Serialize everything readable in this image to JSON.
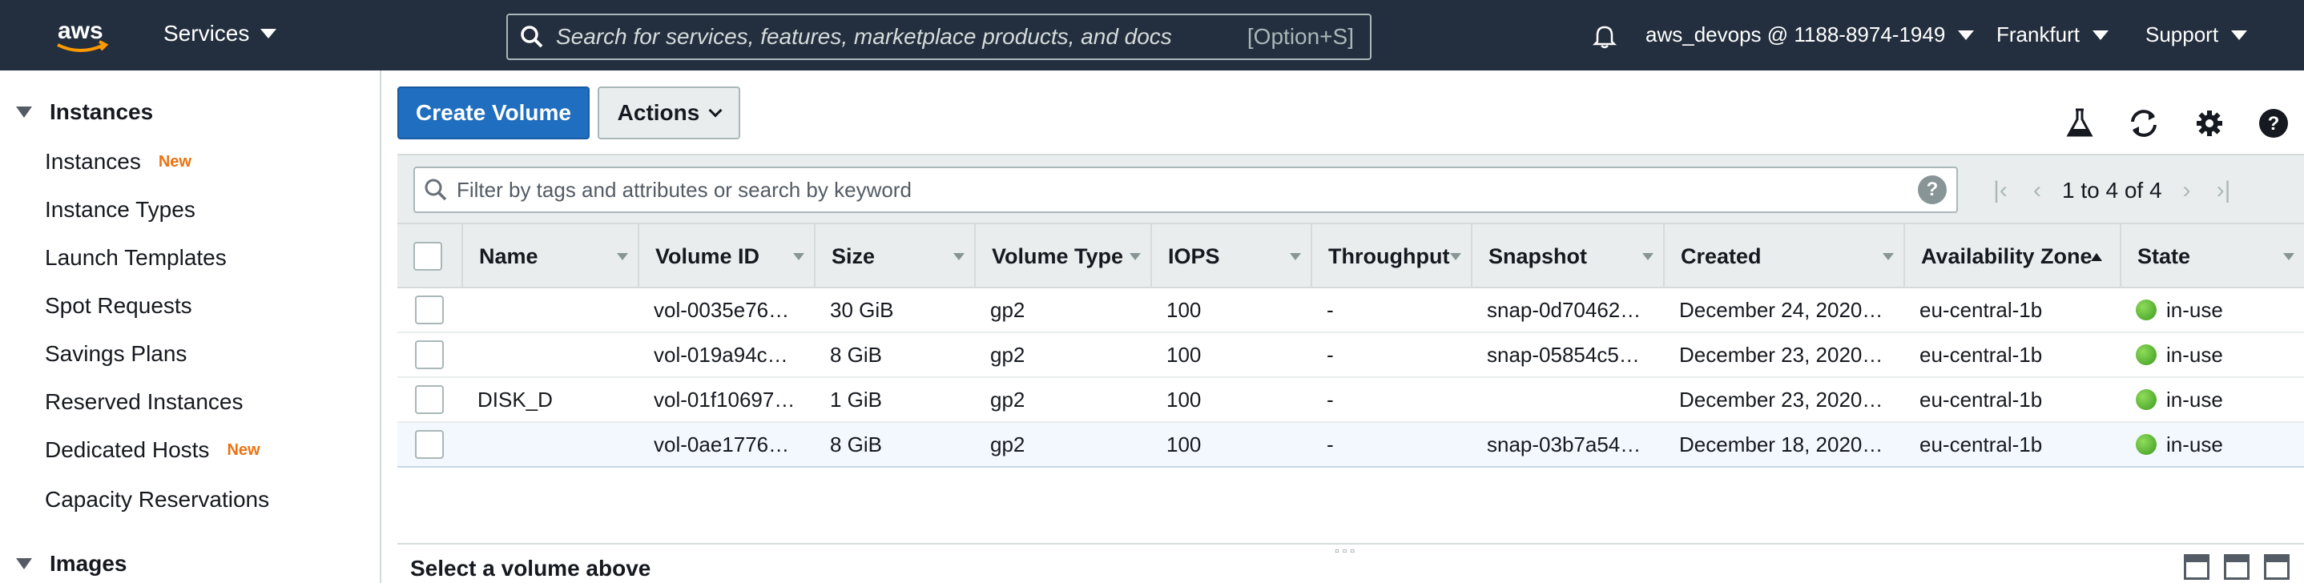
{
  "topnav": {
    "logo": "aws",
    "services": "Services",
    "search_placeholder": "Search for services, features, marketplace products, and docs",
    "search_shortcut": "[Option+S]",
    "account": "aws_devops @ 1188-8974-1949",
    "region": "Frankfurt",
    "support": "Support"
  },
  "sidebar": {
    "section_instances": "Instances",
    "items": [
      {
        "label": "Instances",
        "badge": "New"
      },
      {
        "label": "Instance Types",
        "badge": ""
      },
      {
        "label": "Launch Templates",
        "badge": ""
      },
      {
        "label": "Spot Requests",
        "badge": ""
      },
      {
        "label": "Savings Plans",
        "badge": ""
      },
      {
        "label": "Reserved Instances",
        "badge": ""
      },
      {
        "label": "Dedicated Hosts",
        "badge": "New"
      },
      {
        "label": "Capacity Reservations",
        "badge": ""
      }
    ],
    "section_images": "Images"
  },
  "toolbar": {
    "create_label": "Create Volume",
    "actions_label": "Actions"
  },
  "filter": {
    "placeholder": "Filter by tags and attributes or search by keyword",
    "help": "?",
    "pager": "1 to 4 of 4"
  },
  "table": {
    "columns": [
      "Name",
      "Volume ID",
      "Size",
      "Volume Type",
      "IOPS",
      "Throughput",
      "Snapshot",
      "Created",
      "Availability Zone",
      "State"
    ],
    "rows": [
      {
        "name": "",
        "volume_id": "vol-0035e76…",
        "size": "30 GiB",
        "type": "gp2",
        "iops": "100",
        "throughput": "-",
        "snapshot": "snap-0d70462…",
        "created": "December 24, 2020…",
        "az": "eu-central-1b",
        "state": "in-use"
      },
      {
        "name": "",
        "volume_id": "vol-019a94c…",
        "size": "8 GiB",
        "type": "gp2",
        "iops": "100",
        "throughput": "-",
        "snapshot": "snap-05854c5…",
        "created": "December 23, 2020…",
        "az": "eu-central-1b",
        "state": "in-use"
      },
      {
        "name": "DISK_D",
        "volume_id": "vol-01f10697…",
        "size": "1 GiB",
        "type": "gp2",
        "iops": "100",
        "throughput": "-",
        "snapshot": "",
        "created": "December 23, 2020…",
        "az": "eu-central-1b",
        "state": "in-use"
      },
      {
        "name": "",
        "volume_id": "vol-0ae1776…",
        "size": "8 GiB",
        "type": "gp2",
        "iops": "100",
        "throughput": "-",
        "snapshot": "snap-03b7a54…",
        "created": "December 18, 2020…",
        "az": "eu-central-1b",
        "state": "in-use"
      }
    ]
  },
  "details": {
    "select_text": "Select a volume above"
  },
  "colors": {
    "nav_bg": "#232f3e",
    "primary": "#1f6ebf",
    "accent_orange": "#ec7211",
    "status_green": "#3c9a1f"
  }
}
